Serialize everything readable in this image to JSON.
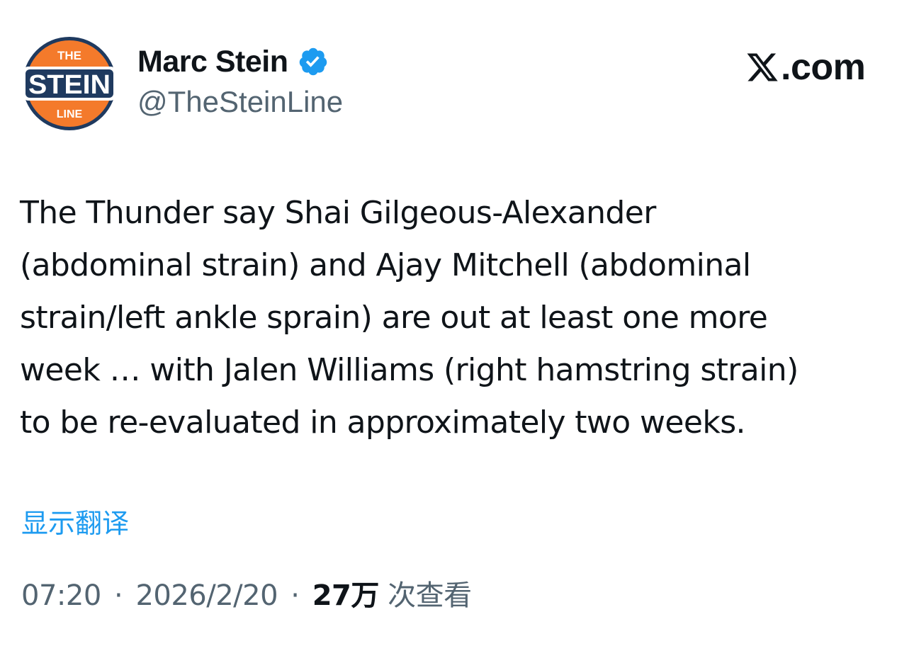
{
  "author": {
    "display_name": "Marc Stein",
    "handle": "@TheSteinLine",
    "verified": true,
    "avatar_text": {
      "top": "THE",
      "middle": "STEIN",
      "bottom": "LINE"
    }
  },
  "brand": {
    "text": ".com",
    "icon": "x-logo-icon"
  },
  "tweet": {
    "lines": [
      "The Thunder say Shai Gilgeous-Alexander",
      "(abdominal strain) and Ajay Mitchell (abdominal",
      "strain/left ankle sprain) are out at least one more",
      "week … with Jalen Williams (right hamstring strain)",
      "to be re-evaluated in approximately two weeks."
    ]
  },
  "translate_link": "显示翻译",
  "meta": {
    "time": "07:20",
    "separator": "·",
    "date": "2026/2/20",
    "views_count": "27万",
    "views_label": "次查看"
  },
  "colors": {
    "text": "#0f1419",
    "secondary": "#536471",
    "link": "#1d9bf0",
    "verified": "#1d9bf0",
    "avatar_orange": "#f47a2b",
    "avatar_navy": "#1f3a5f"
  }
}
